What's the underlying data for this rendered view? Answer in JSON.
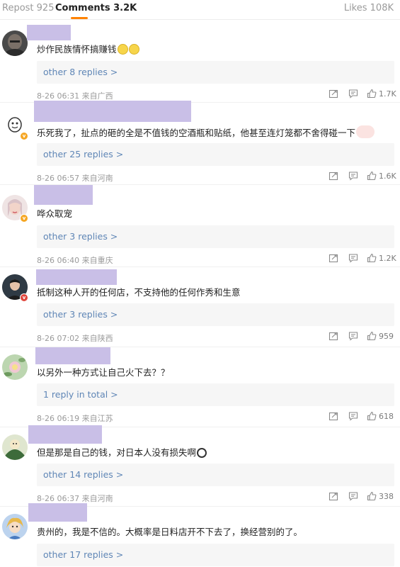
{
  "tabs": {
    "repost": "Repost 925",
    "comments": "Comments 3.2K",
    "likes": "Likes 108K"
  },
  "colors": {
    "accent": "#ff8200",
    "link": "#5f86b6",
    "name_redaction": "#c9bfe7"
  },
  "comments": [
    {
      "text": "炒作民族情怀搞赚钱",
      "emoji": [
        "yellow-face-icon",
        "yellow-face-icon"
      ],
      "replies": "other 8 replies >",
      "date": "8-26 06:31 来自广西",
      "likes": "1.7K"
    },
    {
      "text": "乐死我了，扯点的砸的全是不值钱的空酒瓶和贴纸，他甚至连灯笼都不舍得碰一下",
      "emoji": [
        "pig-face-icon"
      ],
      "replies": "other 25 replies >",
      "date": "8-26 06:57 来自河南",
      "likes": "1.6K"
    },
    {
      "text": "哗众取宠",
      "emoji": [],
      "replies": "other 3 replies >",
      "date": "8-26 06:40 来自重庆",
      "likes": "1.2K"
    },
    {
      "text": "抵制这种人开的任何店，不支持他的任何作秀和生意",
      "emoji": [],
      "replies": "other 3 replies >",
      "date": "8-26 07:02 来自陕西",
      "likes": "959"
    },
    {
      "text": "以另外一种方式让自己火下去？？",
      "emoji": [],
      "replies": "1 reply in total >",
      "date": "8-26 06:19 来自江苏",
      "likes": "618"
    },
    {
      "text": "但是那是自己的钱，对日本人没有损失啊",
      "emoji": [
        "panda-face-icon"
      ],
      "replies": "other 14 replies >",
      "date": "8-26 06:37 来自河南",
      "likes": "338"
    },
    {
      "text": "贵州的，我是不信的。大概率是日料店开不下去了，换经营别的了。",
      "emoji": [],
      "replies": "other 17 replies >",
      "date": "",
      "likes": ""
    }
  ]
}
